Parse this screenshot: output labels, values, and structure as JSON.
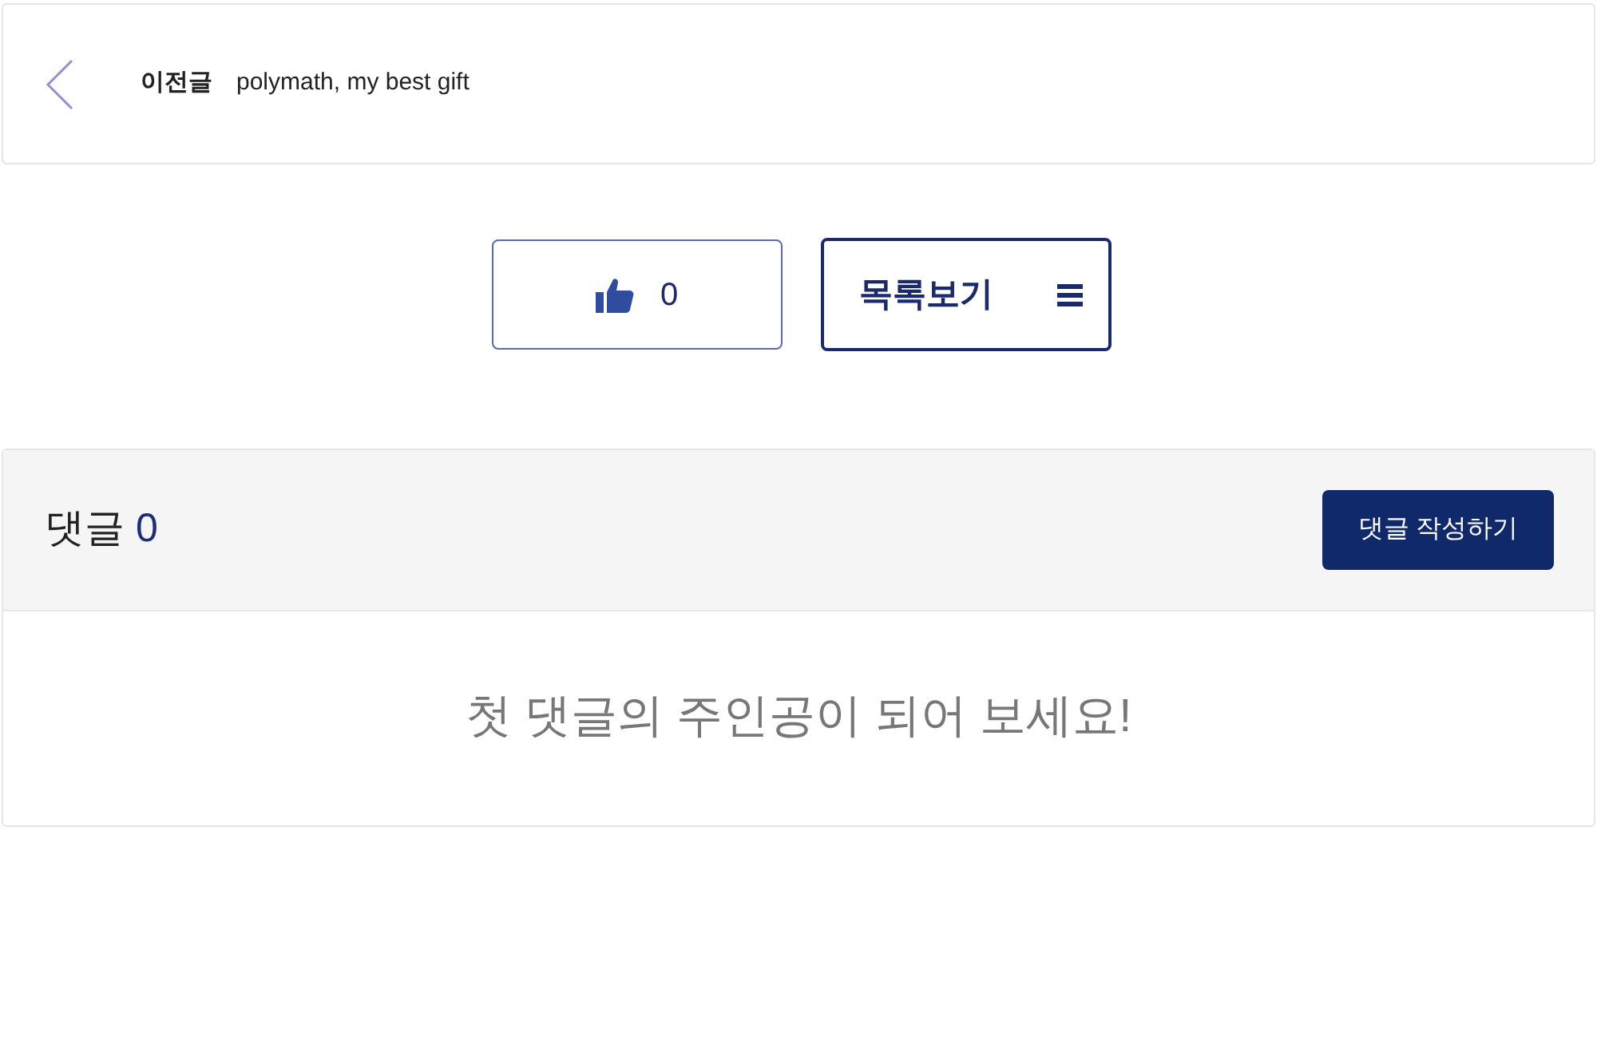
{
  "prev_post": {
    "label": "이전글",
    "title": "polymath, my best gift"
  },
  "actions": {
    "like": {
      "count": "0"
    },
    "list_button": {
      "label": "목록보기"
    }
  },
  "comments": {
    "title": "댓글",
    "count": "0",
    "write_button": "댓글 작성하기",
    "empty_message": "첫 댓글의 주인공이 되어 보세요!"
  }
}
